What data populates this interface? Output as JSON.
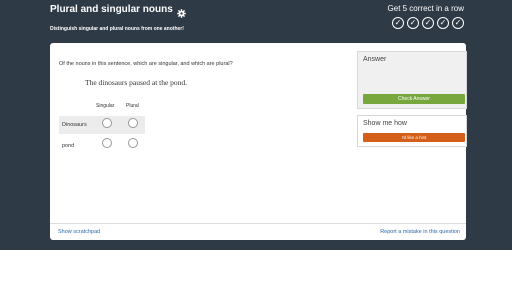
{
  "header": {
    "title": "Plural and singular nouns",
    "subtitle": "Distinguish singular and plural nouns from one another!",
    "streak_label": "Get 5 correct in a row",
    "streak_checks": [
      "✓",
      "✓",
      "✓",
      "✓",
      "✓"
    ],
    "icons": {
      "settings": "gear-icon",
      "streak": "checkmark-circle-icon"
    }
  },
  "exercise": {
    "question": "Of the nouns in this sentence, which are singular, and which are plural?",
    "sentence": "The dinosaurs paused at the pond.",
    "columns": [
      "Singular",
      "Plural"
    ],
    "rows": [
      {
        "label": "Dinosaurs"
      },
      {
        "label": "pond"
      }
    ]
  },
  "footer": {
    "scratchpad": "Show scratchpad",
    "report": "Report a mistake in this question"
  },
  "answer_panel": {
    "title": "Answer",
    "check_button": "Check Answer"
  },
  "hint_panel": {
    "title": "Show me how",
    "hint_button": "I'd like a hint"
  },
  "colors": {
    "header_bg": "#2f3a47",
    "check_button": "#77a73d",
    "hint_button": "#d35f1a",
    "link": "#2a6aad"
  }
}
